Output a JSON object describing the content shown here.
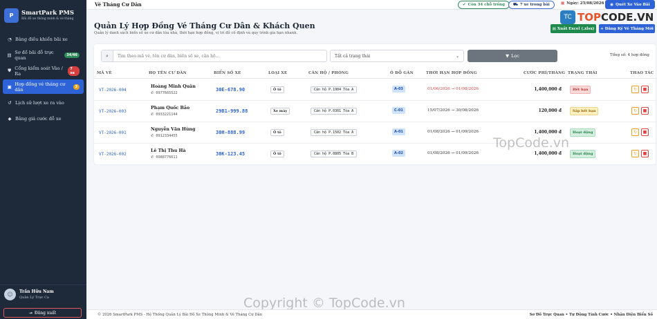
{
  "sidebar": {
    "brand_name": "SmartPark PMS",
    "brand_sub": "Bãi đỗ xe thông minh & vé tháng",
    "brand_logo": "P",
    "items": [
      {
        "label": "Bảng điều khiển bãi xe",
        "icon": "dashboard-icon",
        "glyph": "◔",
        "badge": ""
      },
      {
        "label": "Sơ đồ bãi đỗ trực quan",
        "icon": "map-icon",
        "glyph": "▤",
        "badge": "34/46",
        "badge_color": "#2e8b57"
      },
      {
        "label": "Cổng kiểm soát Vào / Ra",
        "icon": "shield-icon",
        "glyph": "⛊",
        "badge": "7 xe",
        "badge_color": "#d63f3f"
      },
      {
        "label": "Hợp đồng vé tháng cư dân",
        "icon": "contract-icon",
        "glyph": "▣",
        "badge": "3",
        "badge_color": "#e8a21c",
        "active": true
      },
      {
        "label": "Lịch sử lượt xe ra vào",
        "icon": "history-icon",
        "glyph": "↺",
        "badge": ""
      },
      {
        "label": "Bảng giá cước đỗ xe",
        "icon": "tag-icon",
        "glyph": "◆",
        "badge": ""
      }
    ],
    "user": {
      "name": "Trần Hữu Nam",
      "role": "Quản Lý Trực Ca",
      "avatar_glyph": "☺"
    },
    "logout_label": "Đăng xuất",
    "logout_glyph": "⇥"
  },
  "topbar": {
    "title": "Vé Tháng Cư Dân",
    "free_slots": "Còn 34 chỗ trống",
    "cars_in_lot": "7 xe trong bãi",
    "date": "Ngày: 25/08/2026",
    "date_glyph": "▦",
    "quick_entry": "Quét Xe Vào Bãi",
    "car_glyph": "⛟",
    "camera_glyph": "◉",
    "check_glyph": "✔"
  },
  "watermark": {
    "logo_mark": "TC",
    "logo_text_a": "TOP",
    "logo_text_b": "CODE.VN",
    "text1": "TopCode.vn",
    "text2": "Copyright © TopCode.vn"
  },
  "page": {
    "title": "Quản Lý Hợp Đồng Vé Tháng Cư Dân & Khách Quen",
    "subtitle": "Quản lý danh sách biển số xe cư dân tòa nhà, thời hạn hợp đồng, vị trí đỗ cố định và quy trình gia hạn nhanh.",
    "export_label": "Xuất Excel (.xlsx)",
    "add_label": "Đăng Ký Vé Tháng Mới",
    "export_glyph": "▤",
    "add_glyph": "+"
  },
  "filters": {
    "search_placeholder": "Tìm theo mã vé, tên cư dân, biển số xe, căn hộ...",
    "search_glyph": "⌕",
    "status_selected": "Tất cả trạng thái",
    "chevron_glyph": "⌄",
    "filter_label": "Lọc",
    "filter_glyph": "▼",
    "total": "Tổng số: 4 hợp đồng"
  },
  "table": {
    "headers": [
      "MÃ VÉ",
      "HỌ TÊN CƯ DÂN",
      "BIỂN SỐ XE",
      "LOẠI XE",
      "CĂN HỘ / PHÒNG",
      "Ô ĐỖ GÁN",
      "THỜI HẠN HỢP ĐỒNG",
      "CƯỚC PHÍ/THÁNG",
      "TRẠNG THÁI",
      "THAO TÁC"
    ],
    "phone_glyph": "✆",
    "edit_glyph": "↻",
    "delete_glyph": "■",
    "rows": [
      {
        "code": "VT-2026-004",
        "name": "Hoàng Minh Quân",
        "phone": "0977665522",
        "plate": "30E-678.90",
        "type": "Ô tô",
        "apartment": "Căn hộ P.1904 Tòa A",
        "slot": "A-03",
        "period": "01/06/2026 → 01/08/2026",
        "fee": "1,400,000 đ",
        "status": "Hết hạn",
        "status_kind": "expired"
      },
      {
        "code": "VT-2026-003",
        "name": "Phạm Quốc Bảo",
        "phone": "0933221144",
        "plate": "29B1-999.88",
        "type": "Xe máy",
        "apartment": "Căn hộ P.0301 Tòa A",
        "slot": "C-01",
        "period": "15/07/2026 → 30/08/2026",
        "fee": "120,000 đ",
        "status": "Sắp hết hạn",
        "status_kind": "soon"
      },
      {
        "code": "VT-2026-001",
        "name": "Nguyễn Văn Hùng",
        "phone": "0912334455",
        "plate": "30H-888.99",
        "type": "Ô tô",
        "apartment": "Căn hộ P.1502 Tòa A",
        "slot": "A-01",
        "period": "01/08/2026 → 01/09/2026",
        "fee": "1,400,000 đ",
        "status": "Hoạt động",
        "status_kind": "active"
      },
      {
        "code": "VT-2026-002",
        "name": "Lê Thị Thu Hà",
        "phone": "0988776611",
        "plate": "30K-123.45",
        "type": "Ô tô",
        "apartment": "Căn hộ P.0805 Tòa B",
        "slot": "A-02",
        "period": "01/08/2026 → 01/09/2026",
        "fee": "1,400,000 đ",
        "status": "Hoạt động",
        "status_kind": "active"
      }
    ]
  },
  "footer": {
    "left": "© 2026 SmartPark PMS - Hệ Thống Quản Lý Bãi Đỗ Xe Thông Minh & Vé Tháng Cư Dân",
    "right": "Sơ Đồ Trực Quan • Tự Động Tính Cước • Nhận Diện Biển Số"
  },
  "colors": {
    "sidebar_bg": "#1e2a3a",
    "primary": "#2d63d6",
    "success": "#1e8a4d",
    "danger": "#d63f3f"
  }
}
